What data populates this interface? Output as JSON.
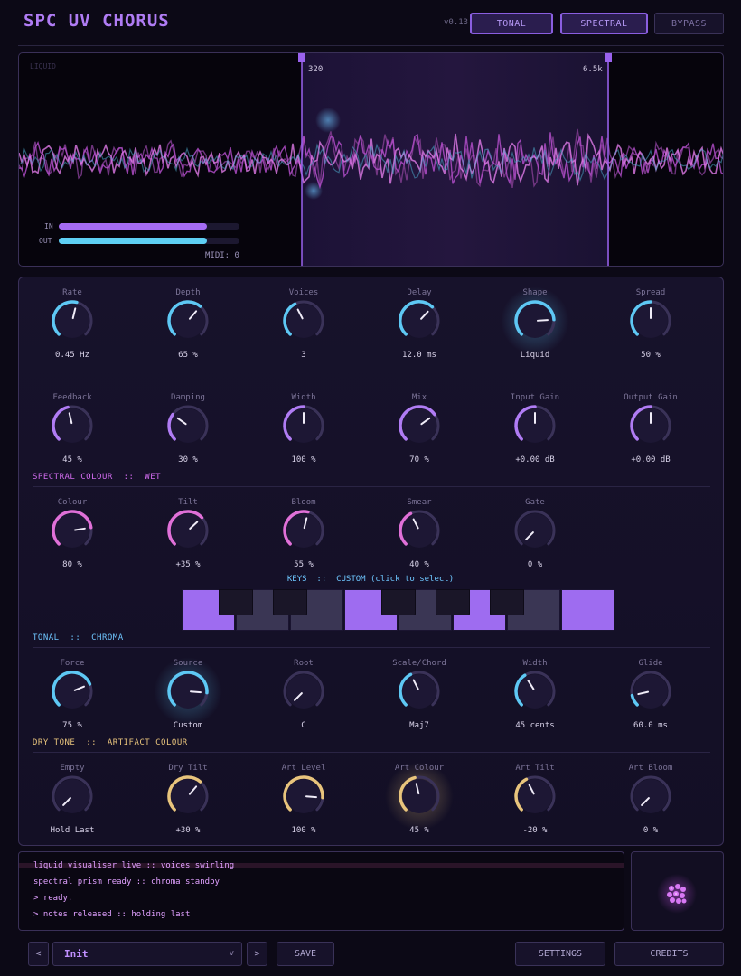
{
  "header": {
    "title": "SPC UV CHORUS",
    "version": "v0.13",
    "buttons": [
      {
        "label": "TONAL",
        "active": true
      },
      {
        "label": "SPECTRAL",
        "active": true
      },
      {
        "label": "BYPASS",
        "active": false
      }
    ]
  },
  "visualiser": {
    "mode_label": "LIQUID",
    "band_low": "320",
    "band_high": "6.5k",
    "in_label": "IN",
    "out_label": "OUT",
    "in_level": 0.82,
    "out_level": 0.82,
    "midi": "MIDI: 0"
  },
  "knob_rows": [
    {
      "knobs": [
        {
          "label": "Rate",
          "value": "0.45 Hz",
          "pos": 0.55,
          "color": "#5ec8f4"
        },
        {
          "label": "Depth",
          "value": "65 %",
          "pos": 0.65,
          "color": "#5ec8f4"
        },
        {
          "label": "Voices",
          "value": "3",
          "pos": 0.4,
          "color": "#5ec8f4"
        },
        {
          "label": "Delay",
          "value": "12.0 ms",
          "pos": 0.66,
          "color": "#5ec8f4"
        },
        {
          "label": "Shape",
          "value": "Liquid",
          "pos": 0.82,
          "color": "#5ec8f4",
          "glow": true
        },
        {
          "label": "Spread",
          "value": "50 %",
          "pos": 0.5,
          "color": "#5ec8f4"
        }
      ]
    },
    {
      "knobs": [
        {
          "label": "Feedback",
          "value": "45 %",
          "pos": 0.45,
          "color": "#b07cf4"
        },
        {
          "label": "Damping",
          "value": "30 %",
          "pos": 0.3,
          "color": "#b07cf4"
        },
        {
          "label": "Width",
          "value": "100 %",
          "pos": 0.5,
          "color": "#b07cf4"
        },
        {
          "label": "Mix",
          "value": "70 %",
          "pos": 0.7,
          "color": "#b07cf4"
        },
        {
          "label": "Input Gain",
          "value": "+0.00 dB",
          "pos": 0.5,
          "color": "#b07cf4"
        },
        {
          "label": "Output Gain",
          "value": "+0.00 dB",
          "pos": 0.5,
          "color": "#b07cf4"
        }
      ]
    },
    {
      "section": {
        "left": "SPECTRAL COLOUR",
        "right": "WET",
        "color": "#d36cf0"
      },
      "knobs": [
        {
          "label": "Colour",
          "value": "80 %",
          "pos": 0.8,
          "color": "#e070d8"
        },
        {
          "label": "Tilt",
          "value": "+35 %",
          "pos": 0.675,
          "color": "#e070d8"
        },
        {
          "label": "Bloom",
          "value": "55 %",
          "pos": 0.55,
          "color": "#e070d8"
        },
        {
          "label": "Smear",
          "value": "40 %",
          "pos": 0.4,
          "color": "#e070d8"
        },
        {
          "label": "Gate",
          "value": "0 %",
          "pos": 0.0,
          "color": "#e070d8"
        }
      ]
    },
    {
      "section": {
        "left": "TONAL",
        "right": "CHROMA",
        "color": "#6ec6ff"
      },
      "knobs": [
        {
          "label": "Force",
          "value": "75 %",
          "pos": 0.75,
          "color": "#5ec8f4"
        },
        {
          "label": "Source",
          "value": "Custom",
          "pos": 0.85,
          "color": "#5ec8f4",
          "glow": true
        },
        {
          "label": "Root",
          "value": "C",
          "pos": 0.0,
          "color": "#5ec8f4"
        },
        {
          "label": "Scale/Chord",
          "value": "Maj7",
          "pos": 0.4,
          "color": "#5ec8f4"
        },
        {
          "label": "Width",
          "value": "45 cents",
          "pos": 0.38,
          "color": "#5ec8f4"
        },
        {
          "label": "Glide",
          "value": "60.0 ms",
          "pos": 0.12,
          "color": "#5ec8f4"
        }
      ]
    },
    {
      "section": {
        "left": "DRY TONE",
        "right": "ARTIFACT COLOUR",
        "color": "#e8c47c"
      },
      "knobs": [
        {
          "label": "Empty",
          "value": "Hold Last",
          "pos": 0.0,
          "color": "#e8c47c"
        },
        {
          "label": "Dry Tilt",
          "value": "+30 %",
          "pos": 0.65,
          "color": "#e8c47c"
        },
        {
          "label": "Art Level",
          "value": "100 %",
          "pos": 0.85,
          "color": "#e8c47c"
        },
        {
          "label": "Art Colour",
          "value": "45 %",
          "pos": 0.45,
          "color": "#e8c47c",
          "glow": true
        },
        {
          "label": "Art Tilt",
          "value": "-20 %",
          "pos": 0.4,
          "color": "#e8c47c"
        },
        {
          "label": "Art Bloom",
          "value": "0 %",
          "pos": 0.0,
          "color": "#e8c47c"
        }
      ]
    }
  ],
  "keys": {
    "title_left": "KEYS",
    "title_right": "CUSTOM (click to select)",
    "white_active": [
      true,
      false,
      false,
      true,
      false,
      true,
      false,
      true
    ],
    "active_color": "#9e6cf0",
    "inactive_color": "#3a3654"
  },
  "log": {
    "lines": [
      "liquid visualiser live :: voices swirling",
      "spectral prism ready :: chroma standby",
      "> ready.",
      "> notes released :: holding last"
    ]
  },
  "footer": {
    "prev_label": "<",
    "next_label": ">",
    "preset_name": "Init",
    "preset_arrow": "v",
    "save_label": "SAVE",
    "settings_label": "SETTINGS",
    "credits_label": "CREDITS"
  },
  "colors": {
    "accent_purple": "#b07cf4",
    "accent_cyan": "#5ec8f4",
    "accent_pink": "#e070d8",
    "accent_gold": "#e8c47c"
  }
}
